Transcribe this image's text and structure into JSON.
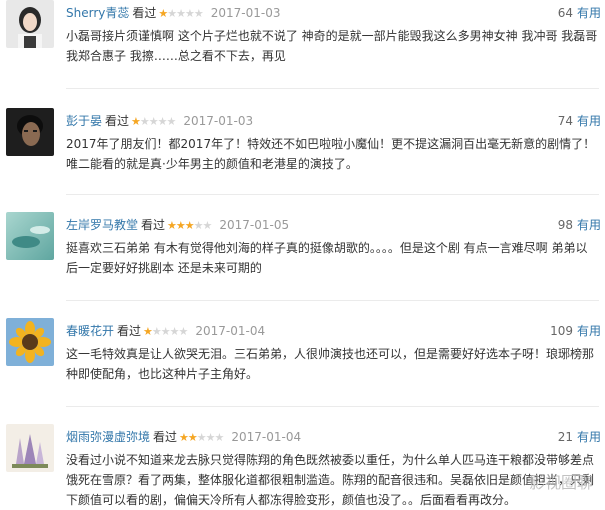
{
  "reviews": [
    {
      "user": "Sherry青蕊",
      "seen": "看过",
      "stars": 1,
      "date": "2017-01-03",
      "votes": "64",
      "useful": "有用",
      "content": "小磊哥接片须谨慎啊 这个片子烂也就不说了 神奇的是就一部片能毁我这么多男神女神 我冲哥 我磊哥 我郑合惠子 我擦……总之看不下去，再见"
    },
    {
      "user": "彭于晏",
      "seen": "看过",
      "stars": 1,
      "date": "2017-01-03",
      "votes": "74",
      "useful": "有用",
      "content": "2017年了朋友们！都2017年了！特效还不如巴啦啦小魔仙！更不提这漏洞百出毫无新意的剧情了！唯二能看的就是真·少年男主的颜值和老港星的演技了。"
    },
    {
      "user": "左岸罗马教堂",
      "seen": "看过",
      "stars": 3,
      "date": "2017-01-05",
      "votes": "98",
      "useful": "有用",
      "content": "挺喜欢三石弟弟 有木有觉得他刘海的样子真的挺像胡歌的。。。。但是这个剧 有点一言难尽啊 弟弟以后一定要好好挑剧本 还是未来可期的"
    },
    {
      "user": "春暖花开",
      "seen": "看过",
      "stars": 1,
      "date": "2017-01-04",
      "votes": "109",
      "useful": "有用",
      "content": "这一毛特效真是让人欲哭无泪。三石弟弟，人很帅演技也还可以，但是需要好好选本子呀！琅琊榜那种即使配角，也比这种片子主角好。"
    },
    {
      "user": "烟雨弥漫虚弥境",
      "seen": "看过",
      "stars": 2,
      "date": "2017-01-04",
      "votes": "21",
      "useful": "有用",
      "content": "没看过小说不知道来龙去脉只觉得陈翔的角色既然被委以重任，为什么单人匹马连干粮都没带够差点饿死在雪原？看了两集，整体服化道都很粗制滥造。陈翔的配音很违和。吴磊依旧是颜值担当，只剩下颜值可以看的剧，偏偏天冷所有人都冻得脸变形，颜值也没了。。后面看看再改分。"
    }
  ],
  "watermark": "影视圈聊",
  "colors": {
    "link": "#3377aa",
    "star": "#f5a623",
    "date": "#999999"
  }
}
